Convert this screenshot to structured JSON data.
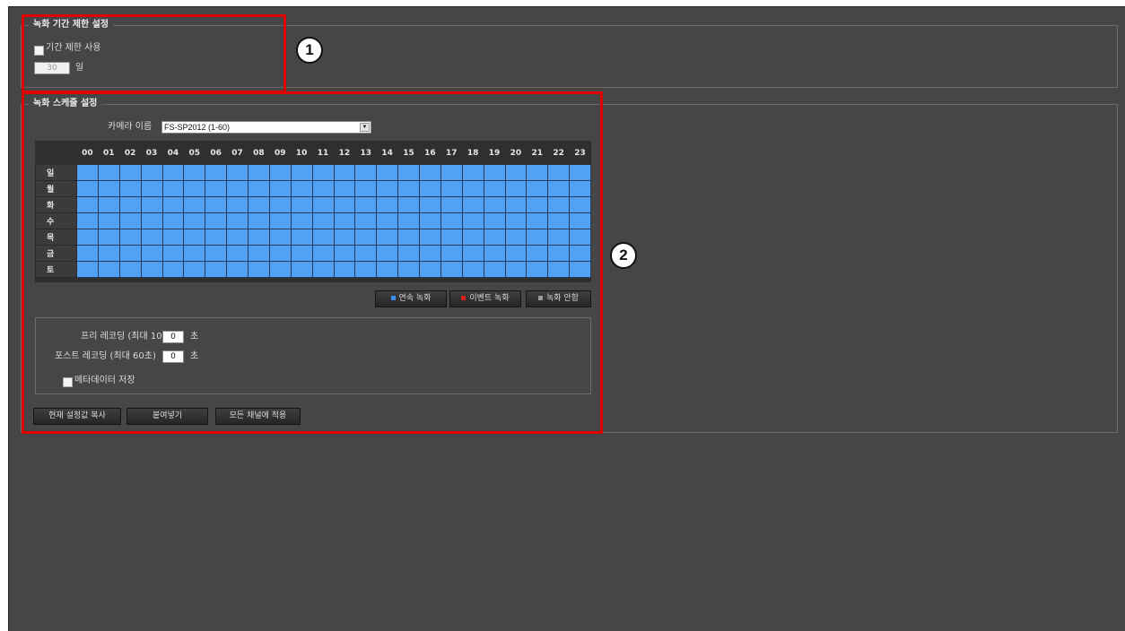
{
  "period": {
    "legend": "녹화 기간 제한 설정",
    "use_label": "기간 제한 사용",
    "days_value": "30",
    "days_unit": "일"
  },
  "schedule": {
    "legend": "녹화 스케줄 설정",
    "camera_label": "카메라 이름",
    "camera_value": "FS-SP2012 (1-60)",
    "hours": [
      "00",
      "01",
      "02",
      "03",
      "04",
      "05",
      "06",
      "07",
      "08",
      "09",
      "10",
      "11",
      "12",
      "13",
      "14",
      "15",
      "16",
      "17",
      "18",
      "19",
      "20",
      "21",
      "22",
      "23"
    ],
    "days": [
      "일",
      "월",
      "화",
      "수",
      "목",
      "금",
      "토"
    ],
    "legend_buttons": [
      {
        "label": "연속 녹화",
        "color": "#3a8ef0"
      },
      {
        "label": "이벤트 녹화",
        "color": "#e02020"
      },
      {
        "label": "녹화 안함",
        "color": "#9a9a9a"
      }
    ],
    "pre_label": "프리 레코딩 (최대 10초)",
    "pre_value": "0",
    "pre_unit": "초",
    "post_label": "포스트 레코딩 (최대 60초)",
    "post_value": "0",
    "post_unit": "초",
    "metadata_label": "메타데이터 저장",
    "btn_copy": "현재 설정값 복사",
    "btn_paste": "붙여넣기",
    "btn_apply_all": "모든 채널에 적용",
    "cell_color": "#52a2f6"
  },
  "callouts": {
    "one": "1",
    "two": "2"
  }
}
